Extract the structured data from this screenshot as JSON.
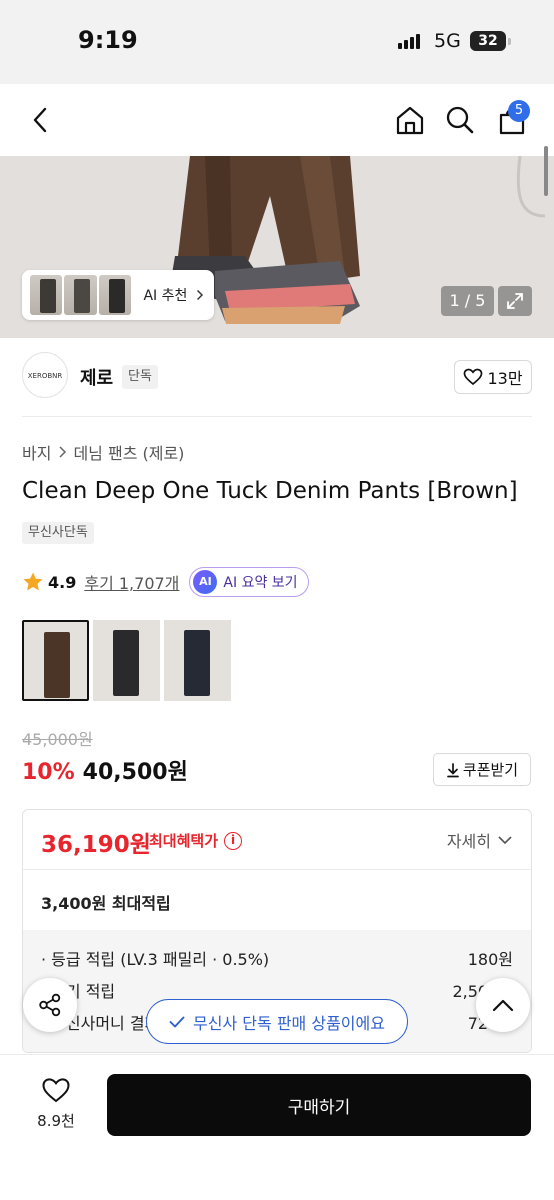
{
  "status_bar": {
    "time": "9:19",
    "network": "5G",
    "battery": "32"
  },
  "header": {
    "cart_count": "5"
  },
  "hero": {
    "ai_recommend_label": "AI 추천",
    "image_counter": "1 / 5"
  },
  "brand": {
    "logo_text": "XEROBNR",
    "name": "제로",
    "tag": "단독",
    "likes": "13만"
  },
  "breadcrumb": {
    "category": "바지",
    "subcategory": "데님 팬츠 (제로)"
  },
  "product": {
    "title": "Clean Deep One Tuck Denim Pants [Brown]",
    "exclusive_tag": "무신사단독",
    "rating": "4.9",
    "reviews_label": "후기 1,707개",
    "ai_badge": "AI",
    "ai_summary_label": "AI 요약 보기"
  },
  "thumbnails": [
    {
      "name": "brown",
      "color": "#4a3527"
    },
    {
      "name": "black",
      "color": "#2a2a2c"
    },
    {
      "name": "navy",
      "color": "#252a35"
    }
  ],
  "pricing": {
    "original": "45,000원",
    "discount": "10%",
    "price": "40,500원",
    "coupon_label": "쿠폰받기"
  },
  "benefit": {
    "max_price": "36,190원",
    "max_label": "최대혜택가",
    "info_symbol": "i",
    "detail_label": "자세히",
    "points_title": "3,400원 최대적립",
    "rows": [
      {
        "label": "· 등급 적립 (LV.3 패밀리 · 0.5%)",
        "value": "180원"
      },
      {
        "label": "· 후기 적립",
        "value": "2,500원"
      },
      {
        "label": "· 무신사머니 결제 적립",
        "value": "720원"
      }
    ]
  },
  "toast": {
    "message": "무신사 단독 판매 상품이에요"
  },
  "bottom_bar": {
    "like_count": "8.9천",
    "buy_label": "구매하기"
  },
  "colors": {
    "accent_red": "#e8242d",
    "accent_blue": "#2f5fd0",
    "badge_blue": "#2f6ee8",
    "ai_purple": "#7b5cff"
  },
  "icons": [
    "back-icon",
    "home-icon",
    "search-icon",
    "cart-icon",
    "chevron-right-icon",
    "expand-icon",
    "heart-icon",
    "star-icon",
    "download-icon",
    "info-icon",
    "chevron-down-icon",
    "share-icon",
    "chevron-up-icon",
    "check-icon"
  ]
}
